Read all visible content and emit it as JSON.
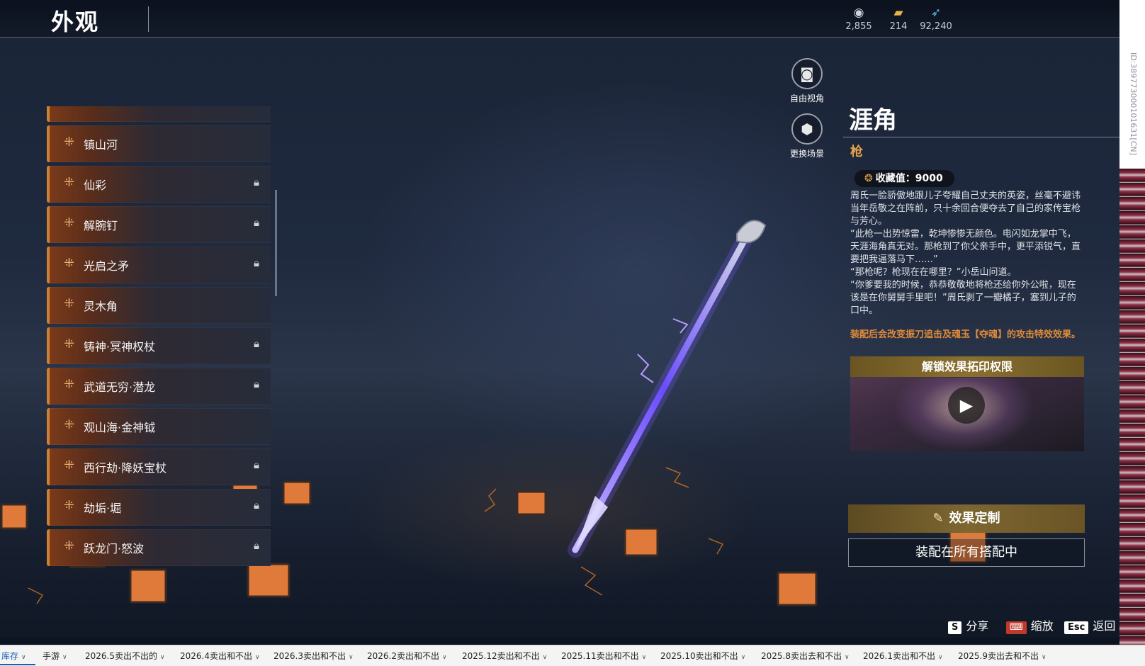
{
  "header": {
    "title": "外观",
    "currencies": [
      {
        "icon": "coin-icon",
        "value": "2,855"
      },
      {
        "icon": "ticket-icon",
        "value": "214"
      },
      {
        "icon": "feather-icon",
        "value": "92,240"
      }
    ]
  },
  "version_id": "ID:389773000101631[CN]",
  "list": {
    "items": [
      {
        "name": "…",
        "locked": false
      },
      {
        "name": "镇山河",
        "locked": false
      },
      {
        "name": "仙彩",
        "locked": true
      },
      {
        "name": "解腕钉",
        "locked": true
      },
      {
        "name": "光启之矛",
        "locked": true
      },
      {
        "name": "灵木角",
        "locked": false
      },
      {
        "name": "铸神·冥神权杖",
        "locked": true
      },
      {
        "name": "武道无穷·潜龙",
        "locked": true
      },
      {
        "name": "观山海·金神钺",
        "locked": false
      },
      {
        "name": "西行劫·降妖宝杖",
        "locked": true
      },
      {
        "name": "劫垢·堀",
        "locked": true
      },
      {
        "name": "跃龙门·怒波",
        "locked": true
      }
    ]
  },
  "side_buttons": {
    "free_view": "自由视角",
    "change_scene": "更换场景"
  },
  "detail": {
    "name": "涯角",
    "type": "枪",
    "collection": "收藏值：9000",
    "description": "周氏一脸骄傲地跟儿子夸耀自己丈夫的英姿，丝毫不避讳当年岳敬之在阵前，只十余回合便夺去了自己的家传宝枪与芳心。\n“此枪一出势惊雷，乾坤惨惨无颜色。电闪如龙掌中飞，天涯海角真无对。那枪到了你父亲手中，更平添锐气，直要把我逼落马下……”\n“那枪呢？枪现在在哪里？”小岳山问道。\n“你爹要我的时候，恭恭敬敬地将枪还给你外公啦，现在该是在你舅舅手里吧！”周氏剥了一瓣橘子，塞到儿子的口中。",
    "effect_note": "装配后会改变振刀追击及魂玉【夺魂】的攻击特效效果。",
    "unlock_title": "解锁效果拓印权限",
    "custom_button": "效果定制",
    "equip_button": "装配在所有搭配中"
  },
  "hints": [
    {
      "key": "S",
      "label": "分享"
    },
    {
      "key": "⌨",
      "label": "缩放"
    },
    {
      "key": "Esc",
      "label": "返回"
    }
  ],
  "sheet_tabs": [
    "库存",
    "手游",
    "2026.5卖出不出的",
    "2026.4卖出和不出",
    "2026.3卖出和不出",
    "2026.2卖出和不出",
    "2025.12卖出和不出",
    "2025.11卖出和不出",
    "2025.10卖出和不出",
    "2025.8卖出去和不出",
    "2026.1卖出和不出",
    "2025.9卖出去和不出"
  ],
  "colors": {
    "accent": "#e6a34a",
    "gold_button": "#7d6630",
    "spear_glow": "#7a5cff"
  }
}
